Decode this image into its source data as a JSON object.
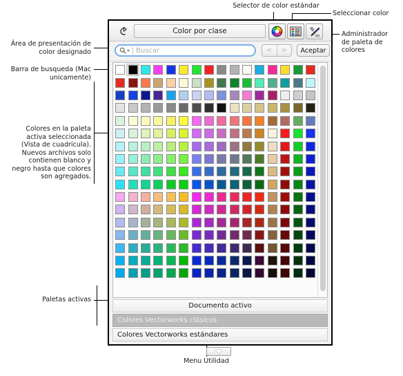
{
  "dialog": {
    "title": "Color por clase",
    "eyedropper_icon": "eyedropper-icon",
    "buttons": {
      "standard_picker": "color-wheel-icon",
      "select_color": "list-view-icon",
      "palette_manager": "tools-icon"
    }
  },
  "search": {
    "placeholder": "Buscar",
    "value": "",
    "magnifier_icon": "search-icon",
    "prev_label": "<",
    "next_label": ">",
    "accept_label": "Aceptar"
  },
  "palettes": {
    "items": [
      {
        "label": "Documento activo",
        "style": "doc",
        "selected": false
      },
      {
        "label": "Colores Vectorworks clásicos",
        "style": "selected",
        "selected": true
      },
      {
        "label": "Colores Vectorworks estándares",
        "style": "normal",
        "selected": false
      }
    ]
  },
  "utility": {
    "menu_icon": "chevron-down-icon"
  },
  "annotations": {
    "designated_color_area": "Área de presentación de\ncolor designado",
    "search_bar": "Barra de busqueda (Mac\nunicamente)",
    "palette_colors": "Colores en la paleta\nactiva seleccionada\n(Vista de cuadrícula).\nNuevos archivos solo\ncontienen blanco y\nnegro hasta que colores\nson agregados.",
    "active_palettes": "Paletas activas",
    "standard_color_picker": "Selector de color estándar",
    "select_color": "Seleccionar color",
    "palette_manager": "Administrador\nde paleta de\ncolores",
    "utility_menu": "Menu Utilidad"
  },
  "grid": {
    "columns": 16,
    "selected_index": 1,
    "colors": [
      "#ffffff",
      "#000000",
      "#2ee8e8",
      "#f23ff0",
      "#1532e8",
      "#fbe92b",
      "#1fe72f",
      "#f32222",
      "#8a8a8a",
      "#b4b4b4",
      "#fbfaee",
      "#1aaee4",
      "#f72a93",
      "#fcdb2a",
      "#169a37",
      "#e52a1f",
      "#e52a1f",
      "#8d1310",
      "#fb7a4a",
      "#cfa573",
      "#fbd0a3",
      "#fdf8d6",
      "#c9e0c4",
      "#a89220",
      "#3f7a4f",
      "#0c8524",
      "#1bbd32",
      "#4eeeb6",
      "#4fb08f",
      "#0f9d9d",
      "#4b7a84",
      "#bcf6f8",
      "#1740c8",
      "#1640e8",
      "#0a1a8c",
      "#4a2596",
      "#1ba2ef",
      "#b3cfef",
      "#cdd2f3",
      "#b1bdf0",
      "#7e91dd",
      "#a887bb",
      "#f97ad5",
      "#9c2a9c",
      "#ab1f66",
      "#eeeef0",
      "#cfcfcf",
      "#c5c5c5",
      "#e4e4e4",
      "#c9c9c9",
      "#b3b3b3",
      "#9a9a9a",
      "#8b8b8b",
      "#6a6a6a",
      "#4e4e4e",
      "#2f2f2f",
      "#111111",
      "#ece2c2",
      "#ddd0a3",
      "#d6c38a",
      "#cbb76b",
      "#a89141",
      "#77672a",
      "#242213",
      "#daf3de",
      "#fbfbd6",
      "#fafac0",
      "#f8f79a",
      "#f4f262",
      "#fbfb3a",
      "#f46bf0",
      "#ee6bd4",
      "#f26b9e",
      "#ee7676",
      "#f7763f",
      "#f2832a",
      "#a46a36",
      "#b16a63",
      "#64ac64",
      "#6778c2",
      "#cdf0f5",
      "#d7f3dc",
      "#ddf3bb",
      "#e0f39a",
      "#d9ee5f",
      "#dbf42e",
      "#d16bf2",
      "#cd6be6",
      "#ca6bc1",
      "#c17184",
      "#bc7a4d",
      "#cb8526",
      "#f8f0e0",
      "#f71b1b",
      "#17e22d",
      "#1731ef",
      "#b4f1f7",
      "#b6f3dc",
      "#b9f0c2",
      "#bdf0a3",
      "#b8ee7a",
      "#b6f23f",
      "#a76bef",
      "#a76bdd",
      "#a06bc0",
      "#9c7281",
      "#93793f",
      "#948a2a",
      "#eedcc0",
      "#e51818",
      "#12cf25",
      "#1526e3",
      "#9aeef7",
      "#96f2d7",
      "#8dedb1",
      "#8fee8b",
      "#88ee6b",
      "#7bf23f",
      "#7a80ee",
      "#7a78d0",
      "#7b78a8",
      "#6f7b8d",
      "#4f7a55",
      "#4d7a26",
      "#e6cda3",
      "#bd1313",
      "#0fb420",
      "#101fd0",
      "#6ae8f5",
      "#55e8c8",
      "#40dfa1",
      "#40e07a",
      "#3edf45",
      "#3ae81f",
      "#3a6de8",
      "#3a6bcc",
      "#2f6b9e",
      "#206b7d",
      "#146a4b",
      "#11751b",
      "#dbb981",
      "#a30f0f",
      "#0b9c1a",
      "#0b18ba",
      "#2edff3",
      "#1ddfbb",
      "#14d493",
      "#11cf5a",
      "#0ccb24",
      "#0ad012",
      "#0a56e8",
      "#0a52c8",
      "#0a5a92",
      "#0a6274",
      "#0a6137",
      "#0a6a12",
      "#cfa763",
      "#8d0b0b",
      "#088615",
      "#0812a0",
      "#f4a9f0",
      "#f4b3cd",
      "#f6b09e",
      "#f6bd81",
      "#f6c05b",
      "#f8bb2a",
      "#f22af2",
      "#ed2ad0",
      "#ed2a93",
      "#ed2a5c",
      "#ef2525",
      "#f02a13",
      "#c49161",
      "#9e0c0c",
      "#06740f",
      "#060f8c",
      "#cdb3f0",
      "#cdb8cd",
      "#d1ae9c",
      "#d6b87f",
      "#d6bc5b",
      "#d8b92a",
      "#d32ad6",
      "#cf2ac3",
      "#ce2a93",
      "#cd2a63",
      "#d12525",
      "#d22a13",
      "#b08352",
      "#8d0a0a",
      "#056310",
      "#050c7d",
      "#b3bbf0",
      "#a9b3cd",
      "#a3b09c",
      "#a8b47f",
      "#aab85b",
      "#acb92a",
      "#a92ad3",
      "#a62ac0",
      "#a32a95",
      "#a22a6b",
      "#a92525",
      "#aa2a13",
      "#9c7447",
      "#7b0808",
      "#045410",
      "#040a6d",
      "#86b8f0",
      "#6cafc9",
      "#66ae9c",
      "#6bb47f",
      "#6ab85b",
      "#6cb92a",
      "#7b2ad3",
      "#762ac0",
      "#742a95",
      "#712a6b",
      "#6e2a4f",
      "#8a1515",
      "#87653a",
      "#6a0707",
      "#034610",
      "#03085e",
      "#3fb5ef",
      "#2aaec4",
      "#28ad98",
      "#2ab47c",
      "#28b859",
      "#2ab92a",
      "#4a2ad3",
      "#452ac0",
      "#442a95",
      "#412a6b",
      "#3e2a4f",
      "#5a1010",
      "#74582f",
      "#580606",
      "#023b0e",
      "#02074f",
      "#0cb2ef",
      "#06aebf",
      "#06ad94",
      "#06b478",
      "#06b855",
      "#06b906",
      "#0b2ad3",
      "#0b2ac0",
      "#0b2a95",
      "#0b2a6b",
      "#0b1a4f",
      "#3a0a38",
      "#1d130a",
      "#470505",
      "#013310",
      "#010640",
      "#06a9e8",
      "#05a2b4",
      "#059e88",
      "#05a46c",
      "#05a84c",
      "#05a905",
      "#0a24c0",
      "#0a24ad",
      "#0a2488",
      "#0a2460",
      "#0a1648",
      "#330932",
      "#190f08",
      "#3d0404",
      "#012d0e",
      "#010536"
    ]
  }
}
